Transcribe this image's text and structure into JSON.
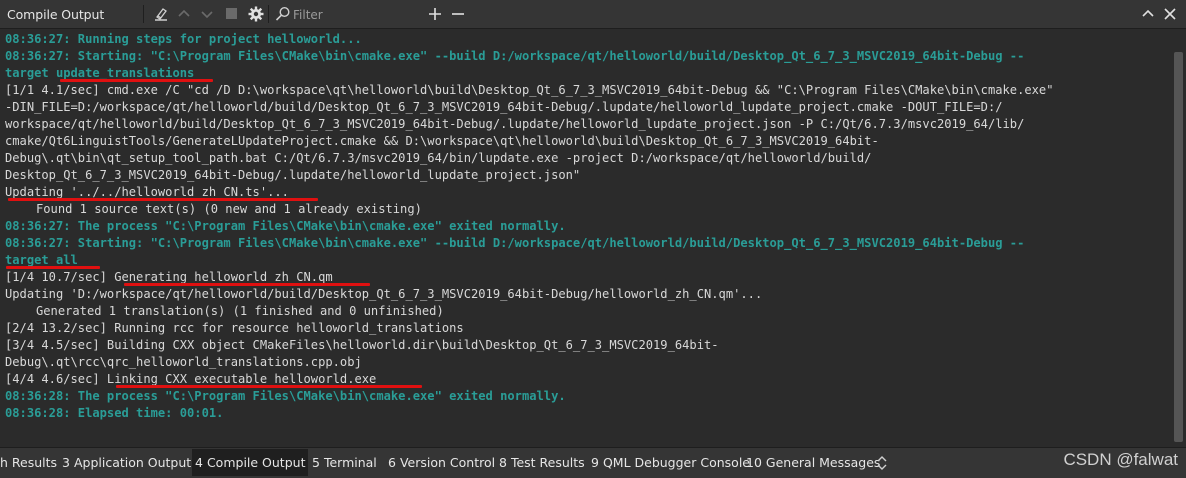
{
  "toolbar": {
    "title": "Compile Output",
    "filter_placeholder": "Filter",
    "icons": [
      "clear-icon",
      "arrow-up-icon",
      "arrow-down-icon",
      "stop-icon",
      "gear-icon",
      "search-icon",
      "plus-icon",
      "minus-icon",
      "chevron-up-icon",
      "close-icon"
    ]
  },
  "output": {
    "lines": [
      {
        "text": "08:36:27: Running steps for project helloworld...",
        "style": "teal"
      },
      {
        "text": "08:36:27: Starting: \"C:\\Program Files\\CMake\\bin\\cmake.exe\" --build D:/workspace/qt/helloworld/build/Desktop_Qt_6_7_3_MSVC2019_64bit-Debug --",
        "style": "teal"
      },
      {
        "text": "target update_translations",
        "style": "teal"
      },
      {
        "text": "[1/1 4.1/sec] cmd.exe /C \"cd /D D:\\workspace\\qt\\helloworld\\build\\Desktop_Qt_6_7_3_MSVC2019_64bit-Debug && \"C:\\Program Files\\CMake\\bin\\cmake.exe\"",
        "style": "normal"
      },
      {
        "text": "-DIN_FILE=D:/workspace/qt/helloworld/build/Desktop_Qt_6_7_3_MSVC2019_64bit-Debug/.lupdate/helloworld_lupdate_project.cmake -DOUT_FILE=D:/",
        "style": "normal"
      },
      {
        "text": "workspace/qt/helloworld/build/Desktop_Qt_6_7_3_MSVC2019_64bit-Debug/.lupdate/helloworld_lupdate_project.json -P C:/Qt/6.7.3/msvc2019_64/lib/",
        "style": "normal"
      },
      {
        "text": "cmake/Qt6LinguistTools/GenerateLUpdateProject.cmake && D:\\workspace\\qt\\helloworld\\build\\Desktop_Qt_6_7_3_MSVC2019_64bit-",
        "style": "normal"
      },
      {
        "text": "Debug\\.qt\\bin\\qt_setup_tool_path.bat C:/Qt/6.7.3/msvc2019_64/bin/lupdate.exe -project D:/workspace/qt/helloworld/build/",
        "style": "normal"
      },
      {
        "text": "Desktop_Qt_6_7_3_MSVC2019_64bit-Debug/.lupdate/helloworld_lupdate_project.json\"",
        "style": "normal"
      },
      {
        "text": "Updating '../../helloworld_zh_CN.ts'...",
        "style": "normal"
      },
      {
        "text": "Found 1 source text(s) (0 new and 1 already existing)",
        "style": "indent"
      },
      {
        "text": "08:36:27: The process \"C:\\Program Files\\CMake\\bin\\cmake.exe\" exited normally.",
        "style": "teal"
      },
      {
        "text": "08:36:27: Starting: \"C:\\Program Files\\CMake\\bin\\cmake.exe\" --build D:/workspace/qt/helloworld/build/Desktop_Qt_6_7_3_MSVC2019_64bit-Debug --",
        "style": "teal"
      },
      {
        "text": "target all",
        "style": "teal"
      },
      {
        "text": "[1/4 10.7/sec] Generating helloworld_zh_CN.qm",
        "style": "normal"
      },
      {
        "text": "Updating 'D:/workspace/qt/helloworld/build/Desktop_Qt_6_7_3_MSVC2019_64bit-Debug/helloworld_zh_CN.qm'...",
        "style": "normal"
      },
      {
        "text": "Generated 1 translation(s) (1 finished and 0 unfinished)",
        "style": "indent"
      },
      {
        "text": "[2/4 13.2/sec] Running rcc for resource helloworld_translations",
        "style": "normal"
      },
      {
        "text": "[3/4 4.5/sec] Building CXX object CMakeFiles\\helloworld.dir\\build\\Desktop_Qt_6_7_3_MSVC2019_64bit-",
        "style": "normal"
      },
      {
        "text": "Debug\\.qt\\rcc\\qrc_helloworld_translations.cpp.obj",
        "style": "normal"
      },
      {
        "text": "[4/4 4.6/sec] Linking CXX executable helloworld.exe",
        "style": "normal"
      },
      {
        "text": "08:36:28: The process \"C:\\Program Files\\CMake\\bin\\cmake.exe\" exited normally.",
        "style": "teal"
      },
      {
        "text": "08:36:28: Elapsed time: 00:01.",
        "style": "teal"
      }
    ],
    "highlight_color": "#e01010"
  },
  "tabs": [
    {
      "num": "",
      "label": "h Results"
    },
    {
      "num": "3",
      "label": "Application Output"
    },
    {
      "num": "4",
      "label": "Compile Output",
      "active": true
    },
    {
      "num": "5",
      "label": "Terminal"
    },
    {
      "num": "6",
      "label": "Version Control"
    },
    {
      "num": "8",
      "label": "Test Results"
    },
    {
      "num": "9",
      "label": "QML Debugger Console"
    },
    {
      "num": "10",
      "label": "General Messages"
    }
  ],
  "watermark": "CSDN @falwat",
  "colors": {
    "background": "#2b2b2b",
    "teal": "#2a9d97",
    "text": "#d8d8d8",
    "underline": "#e01010"
  }
}
